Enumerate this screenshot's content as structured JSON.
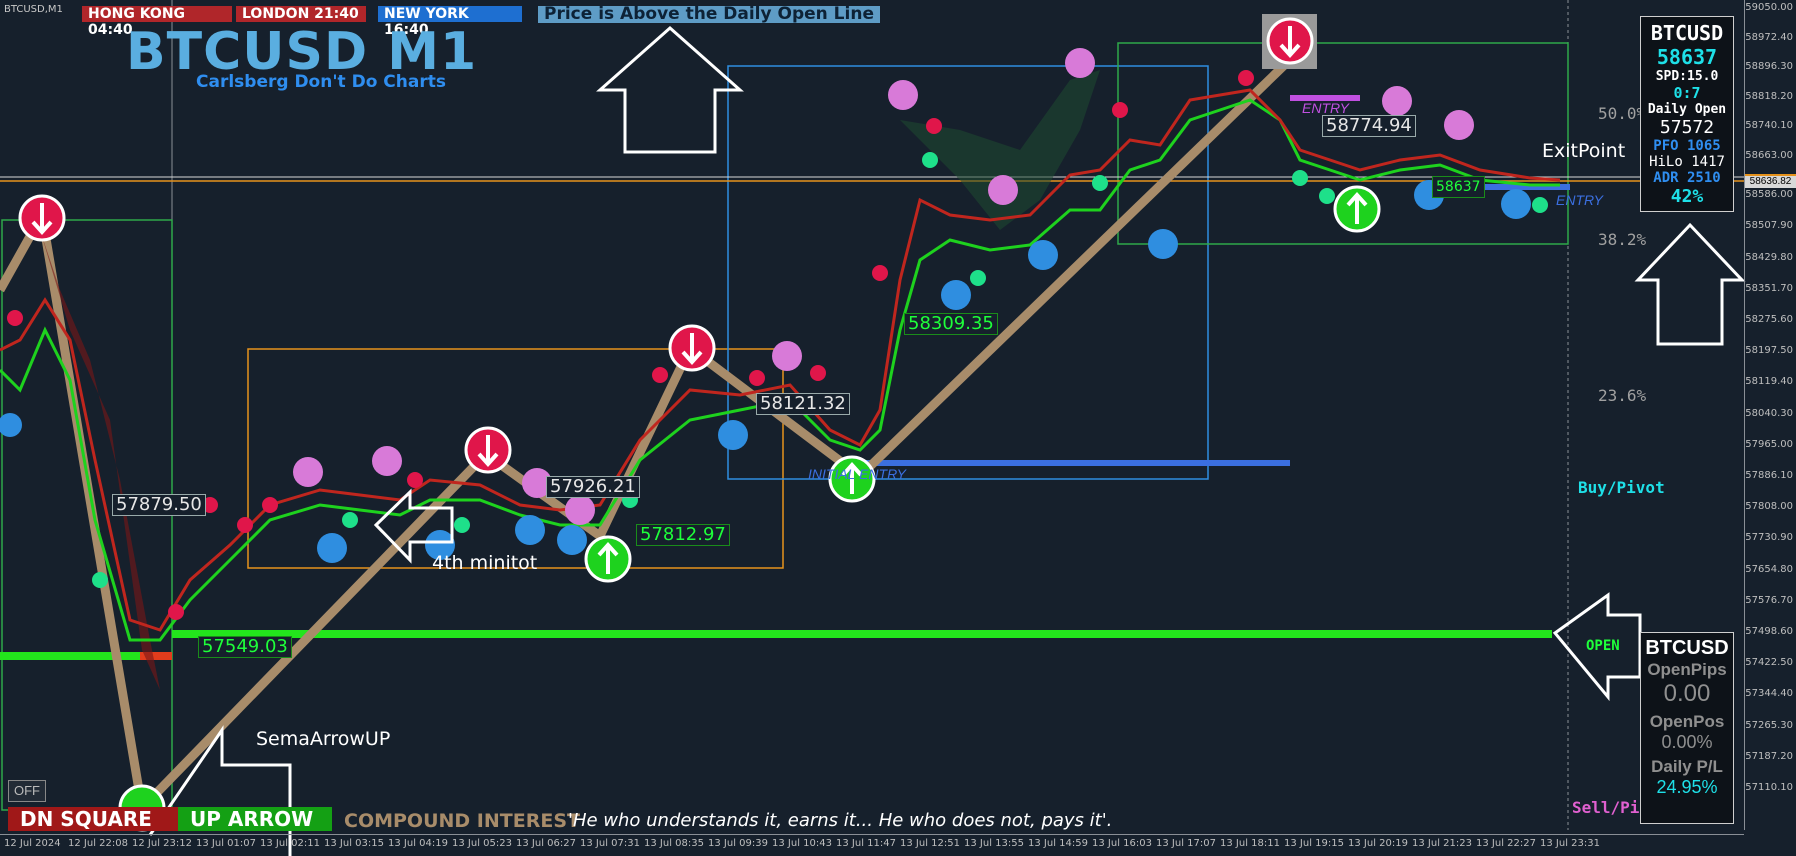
{
  "symbol_label": "BTCUSD,M1",
  "clocks": [
    {
      "label": "HONG KONG 04:40",
      "color": "#b0262a"
    },
    {
      "label": "LONDON 21:40",
      "color": "#b0262a"
    },
    {
      "label": "NEW YORK 16:40",
      "color": "#1e6fd1"
    }
  ],
  "banner": "Price is Above the Daily Open Line",
  "title": "BTCUSD M1",
  "subtitle": "Carlsberg Don't Do Charts",
  "price_tags": {
    "t57879": "57879.50",
    "t57549": "57549.03",
    "t57926": "57926.21",
    "t57812": "57812.97",
    "t58121": "58121.32",
    "t58309": "58309.35",
    "t58774": "58774.94",
    "t58637": "58637"
  },
  "annotations": {
    "fourth_minitot": "4th minitot",
    "sema_arrow_up": "SemaArrowUP",
    "exit_point": "ExitPoint",
    "entry_top": "ENTRY",
    "entry_right": "ENTRY",
    "initial_entry": "INITIAL ENTRY",
    "open": "OPEN",
    "buy_pivot": "Buy/Pivot",
    "sell_pivot": "Sell/Pivot"
  },
  "fib_levels": [
    "50.0%",
    "38.2%",
    "23.6%"
  ],
  "info_panel": {
    "symbol": "BTCUSD",
    "price": "58637",
    "spread": "SPD:15.0",
    "timer": "0:7",
    "daily_open_label": "Daily Open",
    "daily_open_value": "57572",
    "pfo": "PFO 1065",
    "hilo": "HiLo 1417",
    "adr": "ADR 2510",
    "percent": "42%"
  },
  "pl_panel": {
    "symbol": "BTCUSD",
    "open_pips_label": "OpenPips",
    "open_pips_value": "0.00",
    "open_pos_label": "OpenPos",
    "open_pos_value": "0.00%",
    "daily_pl_label": "Daily P/L",
    "daily_pl_value": "24.95%"
  },
  "price_axis": [
    "59050.00",
    "58972.40",
    "58896.30",
    "58818.20",
    "58740.10",
    "58663.00",
    "58636.82",
    "58586.00",
    "58507.90",
    "58429.80",
    "58351.70",
    "58275.60",
    "58197.50",
    "58119.40",
    "58040.30",
    "57965.00",
    "57886.10",
    "57808.00",
    "57730.90",
    "57654.80",
    "57576.70",
    "57498.60",
    "57422.50",
    "57344.40",
    "57265.30",
    "57187.20",
    "57110.10"
  ],
  "time_axis": [
    "12 Jul 2024",
    "12 Jul 22:08",
    "12 Jul 23:12",
    "13 Jul 01:07",
    "13 Jul 02:11",
    "13 Jul 03:15",
    "13 Jul 04:19",
    "13 Jul 05:23",
    "13 Jul 06:27",
    "13 Jul 07:31",
    "13 Jul 08:35",
    "13 Jul 09:39",
    "13 Jul 10:43",
    "13 Jul 11:47",
    "13 Jul 12:51",
    "13 Jul 13:55",
    "13 Jul 14:59",
    "13 Jul 16:03",
    "13 Jul 17:07",
    "13 Jul 18:11",
    "13 Jul 19:15",
    "13 Jul 20:19",
    "13 Jul 21:23",
    "13 Jul 22:27",
    "13 Jul 23:31"
  ],
  "bottom_bar": {
    "off_button": "OFF",
    "dn_square": "DN SQUARE",
    "up_arrow": "UP ARROW",
    "compound_interest": "COMPOUND INTEREST",
    "quote": "'He who understands it, earns it... He who does not, pays it'."
  },
  "colors": {
    "background": "#16202c",
    "open_line": "#23e51c",
    "zigzag": "#a88c6a",
    "ma_fast": "#1ed21e",
    "ma_slow": "#c0261e"
  }
}
